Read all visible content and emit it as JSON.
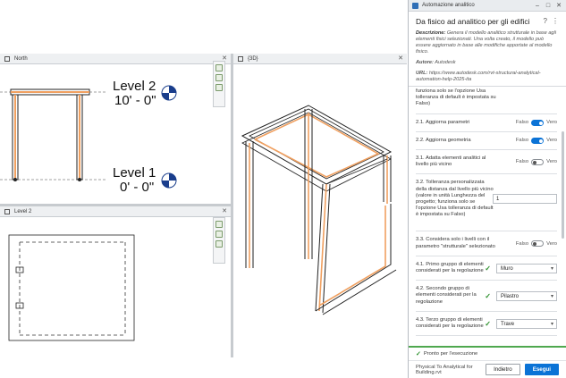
{
  "workspace": {
    "tabs": {
      "north": "North",
      "three_d": "{3D}",
      "level2": "Level 2"
    },
    "levels": [
      {
        "name": "Level 2",
        "elevation": "10' - 0\""
      },
      {
        "name": "Level 1",
        "elevation": "0' - 0\""
      }
    ]
  },
  "panel": {
    "window_title": "Automazione analitico",
    "title": "Da fisico ad analitico per gli edifici",
    "description_label": "Descrizione:",
    "description": "Genera il modello analitico strutturale in base agli elementi fisici selezionati. Una volta creato, il modello può essere aggiornato in base alle modifiche apportate al modello fisico.",
    "author_label": "Autore:",
    "author": "Autodesk",
    "url_label": "URL:",
    "url": "https://www.autodesk.com/rvt-structural-analytical-automation-help-2025-ita",
    "truncated_text": "funziona solo se l'opzione Usa tolleranza di default è impostata su Falso)",
    "rows": [
      {
        "label": "2.1. Aggiorna parametri",
        "off": "Falso",
        "on": "Vero"
      },
      {
        "label": "2.2. Aggiorna geometria",
        "off": "Falso",
        "on": "Vero"
      },
      {
        "label": "3.1. Adatta elementi analitici al livello più vicino",
        "off": "Falso",
        "on": "Vero"
      },
      {
        "label": "3.2. Tolleranza personalizzata della distanza dal livello più vicino (valore in unità Lunghezza del progetto; funziona solo se l'opzione Usa tolleranza di default è impostata su Falso)",
        "value": "1"
      },
      {
        "label": "3.3. Considera solo i livelli con il parametro \"strutturale\" selezionato",
        "off": "Falso",
        "on": "Vero"
      },
      {
        "label": "4.1. Primo gruppo di elementi considerati per la regolazione",
        "value": "Muro"
      },
      {
        "label": "4.2. Secondo gruppo di elementi considerati per la regolazione",
        "value": "Pilastro"
      },
      {
        "label": "4.3. Terzo gruppo di elementi considerati per la regolazione",
        "value": "Trave"
      }
    ],
    "status": "Pronto per l'esecuzione",
    "file_name": "Physical To Analytical for Building.rvt",
    "back_label": "Indietro",
    "run_label": "Esegui"
  },
  "colors": {
    "accent": "#0b73d6",
    "analytical": "#f0a060",
    "success": "#2a8f2a"
  }
}
